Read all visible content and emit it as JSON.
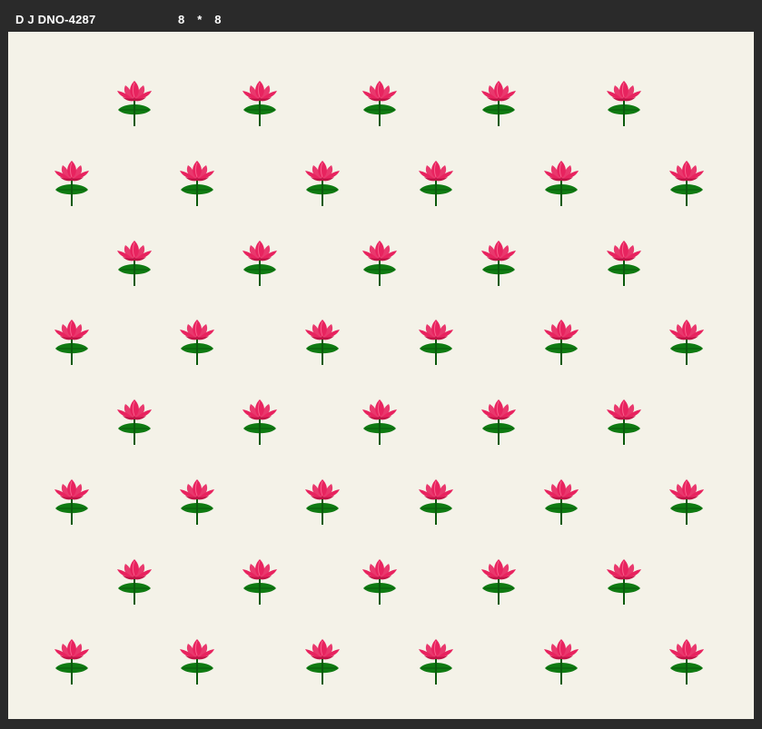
{
  "window": {
    "design_name": "D J DNO-4287",
    "repeat_x": "8",
    "repeat_separator": "*",
    "repeat_y": "8"
  },
  "canvas": {
    "background": "#f4f2e8",
    "motif_name": "lotus-flower",
    "petal_color": "#e8235f",
    "leaf_color": "#0f7a12"
  }
}
